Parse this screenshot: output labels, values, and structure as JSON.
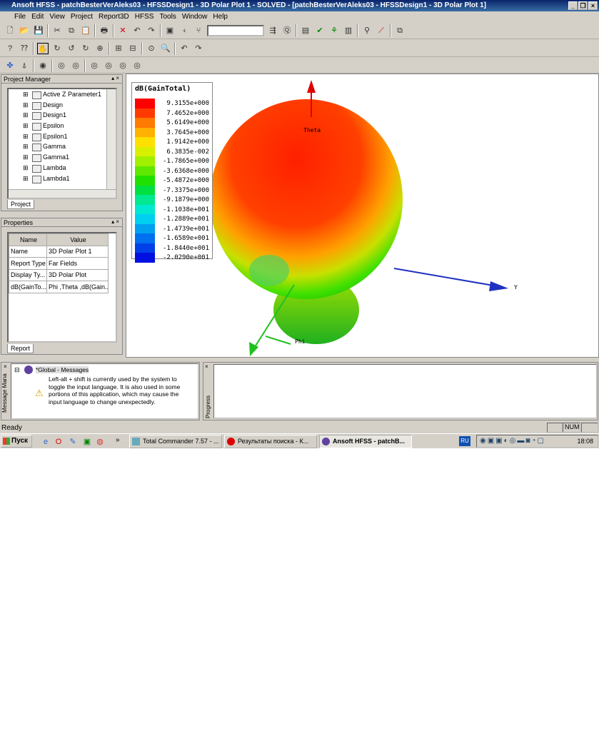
{
  "window": {
    "title": "Ansoft HFSS - patchBesterVerAleks03 - HFSSDesign1 - 3D Polar Plot 1 - SOLVED - [patchBesterVerAleks03 - HFSSDesign1 - 3D Polar Plot 1]"
  },
  "menu": [
    "File",
    "Edit",
    "View",
    "Project",
    "Report3D",
    "HFSS",
    "Tools",
    "Window",
    "Help"
  ],
  "project_manager": {
    "title": "Project Manager",
    "items": [
      "Active Z Parameter1",
      "Design",
      "Design1",
      "Epsilon",
      "Epsilon1",
      "Gamma",
      "Gamma1",
      "Lambda",
      "Lambda1"
    ],
    "tab": "Project"
  },
  "properties": {
    "title": "Properties",
    "headers": [
      "Name",
      "Value"
    ],
    "rows": [
      [
        "Name",
        "3D Polar Plot 1"
      ],
      [
        "Report Type",
        "Far Fields"
      ],
      [
        "Display Ty...",
        "3D Polar Plot"
      ],
      [
        "dB(GainTo...",
        "Phi ,Theta ,dB(Gain..."
      ]
    ],
    "tab": "Report"
  },
  "legend": {
    "title": "dB(GainTotal)",
    "values": [
      "9.3155e+000",
      "7.4652e+000",
      "5.6149e+000",
      "3.7645e+000",
      "1.9142e+000",
      "6.3835e-002",
      "-1.7865e+000",
      "-3.6368e+000",
      "-5.4872e+000",
      "-7.3375e+000",
      "-9.1879e+000",
      "-1.1038e+001",
      "-1.2889e+001",
      "-1.4739e+001",
      "-1.6589e+001",
      "-1.8440e+001",
      "-2.0290e+001"
    ],
    "colors": [
      "#ff0000",
      "#ff3a00",
      "#ff7a00",
      "#ffb000",
      "#ffe000",
      "#d8f000",
      "#a0f000",
      "#60e800",
      "#20e000",
      "#00e040",
      "#00e890",
      "#00e8d0",
      "#00d0f0",
      "#00a0f0",
      "#0070f0",
      "#0040e8",
      "#0010e0"
    ]
  },
  "axes": {
    "theta": "Theta",
    "phi": "Phi",
    "y": "Y"
  },
  "messages": {
    "pane_label": "Message Mana",
    "group": "*Global - Messages",
    "text": "Left-alt + shift is currently used by the system to toggle the input language. It is also used in some portions of this application, which may cause the input language to change unexpectedly."
  },
  "progress": {
    "label": "Progress"
  },
  "status": {
    "text": "Ready",
    "num": "NUM"
  },
  "taskbar": {
    "start": "Пуск",
    "tasks": [
      "Total Commander 7.57 - ...",
      "Результаты поиска - К...",
      "Ansoft HFSS - patchB..."
    ],
    "lang": "RU",
    "clock": "18:08"
  }
}
